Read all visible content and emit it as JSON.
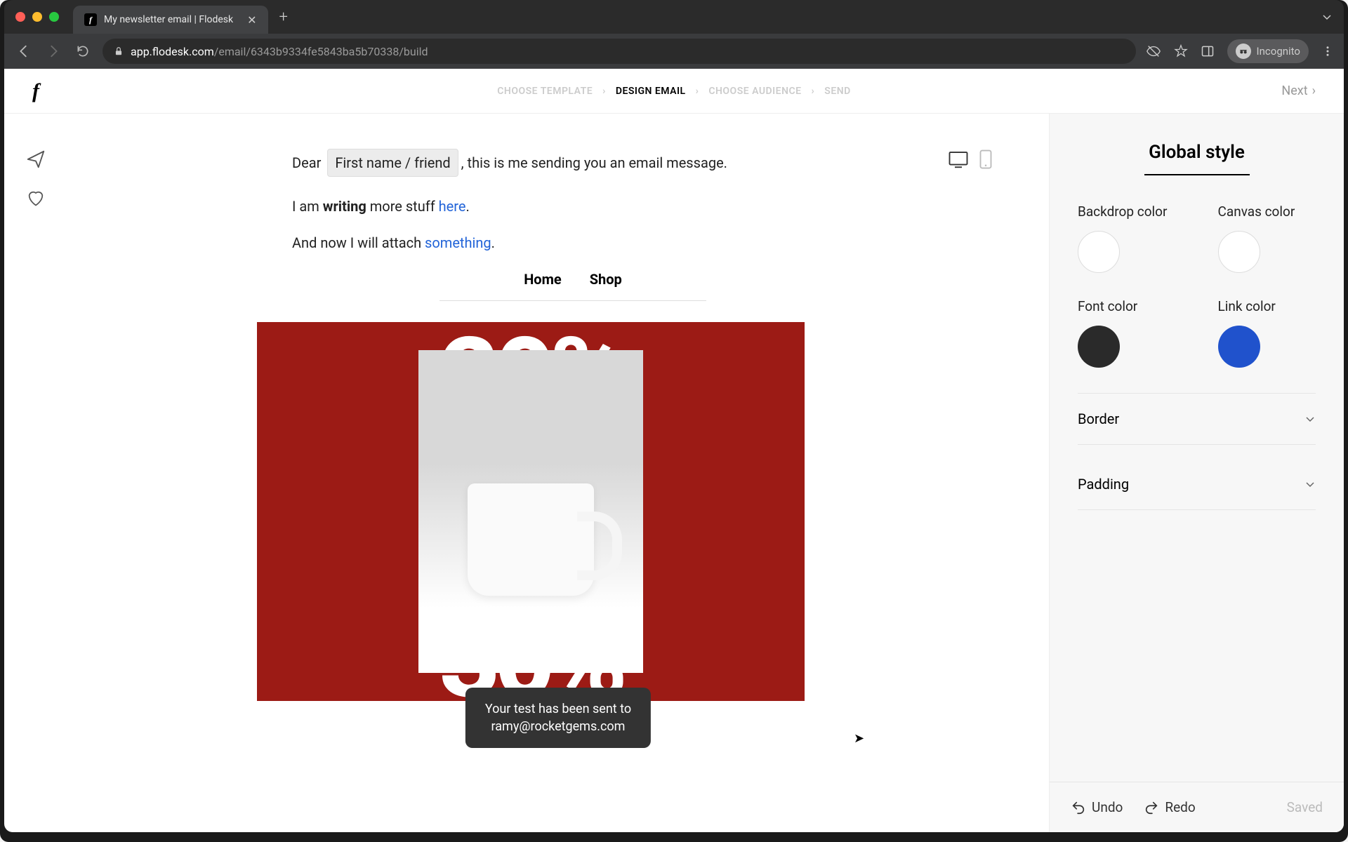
{
  "browser": {
    "tab_title": "My newsletter email | Flodesk",
    "url_host": "app.flodesk.com",
    "url_path": "/email/6343b9334fe5843ba5b70338/build",
    "incognito_label": "Incognito"
  },
  "header": {
    "logo": "f",
    "breadcrumb": [
      "CHOOSE TEMPLATE",
      "DESIGN EMAIL",
      "CHOOSE AUDIENCE",
      "SEND"
    ],
    "breadcrumb_active_index": 1,
    "next_label": "Next"
  },
  "email": {
    "greeting_prefix": "Dear",
    "merge_tag": "First name / friend",
    "greeting_suffix": ", this is me sending you an email message.",
    "para2_pre": "I am ",
    "para2_bold": "writing",
    "para2_mid": " more stuff ",
    "para2_link": "here",
    "para2_end": ".",
    "para3_pre": "And now I will attach ",
    "para3_link": "something",
    "para3_end": ".",
    "nav_items": [
      "Home",
      "Shop"
    ],
    "promo_lines": [
      "20%",
      "30%",
      "30%",
      "30%"
    ]
  },
  "toast": {
    "line1": "Your test has been sent to",
    "line2": "ramy@rocketgems.com"
  },
  "sidebar": {
    "title": "Global style",
    "backdrop_label": "Backdrop color",
    "canvas_label": "Canvas color",
    "font_label": "Font color",
    "link_label": "Link color",
    "colors": {
      "backdrop": "#ffffff",
      "canvas": "#ffffff",
      "font": "#2a2a2a",
      "link": "#2052cc"
    },
    "accordions": [
      "Border",
      "Padding"
    ],
    "undo": "Undo",
    "redo": "Redo",
    "saved": "Saved"
  }
}
